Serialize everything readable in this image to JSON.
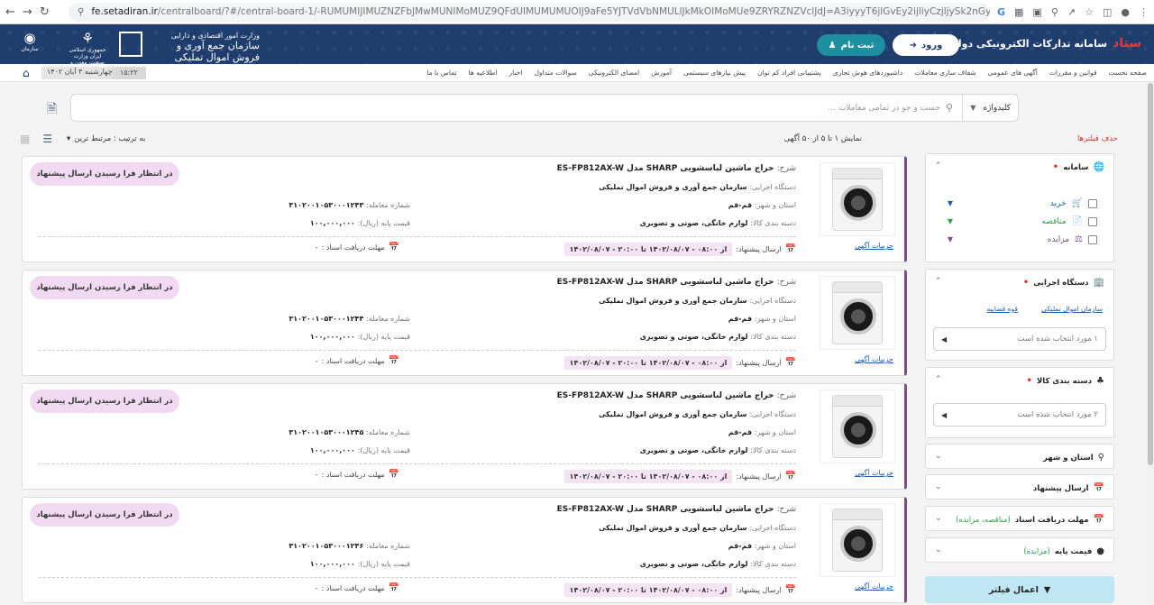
{
  "browser": {
    "host": "fe.setadiran.ir",
    "path": "/centralboard/?#/central-board-1/-RUMUMIJIMUZNZFbJMwMUNIMoMUZ9QFdUIMUMUMUOIJ9aFe5YJTVdVbNMULlJkMkOIMoMUe9ZRYRZNZVclJdJ=A3iyyyT6jlGvEy2ijliyCzjljySk2nGyTsjITzjyiyTuW0mpWn3kGjGlnyCyT0TsTxjl...",
    "g_label": "G"
  },
  "header": {
    "brand_title": "سامانه تدارکات الکترونیکی دولت",
    "brand_logo": "ستاد",
    "login_label": "ورود",
    "register_label": "ثبت نام",
    "org_sub": "وزارت امور اقتصادی و دارایی",
    "org_main": "سازمان جمع آوری و فروش اموال تملیکی",
    "ministry_label": "جمهوری اسلامی ایران وزارت صنعت، معدن و تجارت",
    "emblem3_label": "سازمان"
  },
  "menu": {
    "items": [
      "صفحه نخست",
      "قوانین و مقررات",
      "آگهی های عمومی",
      "شفاف سازی معاملات",
      "داشبوردهای هوش تجاری",
      "پشتیبانی افراد کم توان",
      "پیش نیازهای سیستمی",
      "آموزش",
      "امضای الکترونیکی",
      "سوالات متداول",
      "اخبار",
      "اطلاعیه ها",
      "تماس با ما"
    ],
    "date": "چهارشنبه ۳ آبان ۱۴۰۲",
    "time": "۱۵:۲۲"
  },
  "search": {
    "keyword_label": "کلیدواژه",
    "placeholder": "جست و جو در تمامی معاملات ..."
  },
  "toolbar": {
    "showing": "نمایش ۱ تا ۵ از ۵۰ آگهی",
    "clear_filters": "حذف فیلترها",
    "sort_label": "به ترتیب : مرتبط ترین"
  },
  "labels": {
    "title": "شرح:",
    "device": "دستگاه اجرایی:",
    "province": "استان و شهر:",
    "category": "دسته بندی کالا:",
    "deal_no": "شماره معامله:",
    "base_price": "قیمت پایه (ریال):",
    "send_offer": "ارسال پیشنهاد:",
    "from": "از",
    "to": "تا",
    "deadline": "مهلت دریافت اسناد :",
    "details": "جزییات آگهی"
  },
  "cards": [
    {
      "title": "حراج ماشین لباسشویی SHARP مدل ES-FP812AX-W",
      "device": "سازمان جمع آوری و فروش اموال تملیکی",
      "province": "قم-قم",
      "category": "لوازم خانگی، صوتی و تصویری",
      "deal_no": "۳۱۰۲۰۰۱۰۵۳۰۰۰۱۲۴۳",
      "base_price": "۱۰۰,۰۰۰,۰۰۰",
      "send_from": "۰۸:۰۰ - ۱۴۰۲/۰۸/۰۷",
      "send_to": "۲۰:۰۰ - ۱۴۰۲/۰۸/۰۷",
      "deadline_value": "-",
      "status": "در انتظار فرا رسیدن ارسال پیشنهاد"
    },
    {
      "title": "حراج ماشین لباسشویی SHARP مدل ES-FP812AX-W",
      "device": "سازمان جمع آوری و فروش اموال تملیکی",
      "province": "قم-قم",
      "category": "لوازم خانگی، صوتی و تصویری",
      "deal_no": "۳۱۰۲۰۰۱۰۵۳۰۰۰۱۲۴۴",
      "base_price": "۱۰۰,۰۰۰,۰۰۰",
      "send_from": "۰۸:۰۰ - ۱۴۰۲/۰۸/۰۷",
      "send_to": "۲۰:۰۰ - ۱۴۰۲/۰۸/۰۷",
      "deadline_value": "-",
      "status": "در انتظار فرا رسیدن ارسال پیشنهاد"
    },
    {
      "title": "حراج ماشین لباسشویی SHARP مدل ES-FP812AX-W",
      "device": "سازمان جمع آوری و فروش اموال تملیکی",
      "province": "قم-قم",
      "category": "لوازم خانگی، صوتی و تصویری",
      "deal_no": "۳۱۰۲۰۰۱۰۵۳۰۰۰۱۲۴۵",
      "base_price": "۱۰۰,۰۰۰,۰۰۰",
      "send_from": "۰۸:۰۰ - ۱۴۰۲/۰۸/۰۷",
      "send_to": "۲۰:۰۰ - ۱۴۰۲/۰۸/۰۷",
      "deadline_value": "-",
      "status": "در انتظار فرا رسیدن ارسال پیشنهاد"
    },
    {
      "title": "حراج ماشین لباسشویی SHARP مدل ES-FP812AX-W",
      "device": "سازمان جمع آوری و فروش اموال تملیکی",
      "province": "قم-قم",
      "category": "لوازم خانگی، صوتی و تصویری",
      "deal_no": "۳۱۰۲۰۰۱۰۵۳۰۰۰۱۲۴۶",
      "base_price": "۱۰۰,۰۰۰,۰۰۰",
      "send_from": "۰۸:۰۰ - ۱۴۰۲/۰۸/۰۷",
      "send_to": "۲۰:۰۰ - ۱۴۰۲/۰۸/۰۷",
      "deadline_value": "-",
      "status": "در انتظار فرا رسیدن ارسال پیشنهاد"
    }
  ],
  "sidebar": {
    "system": {
      "title": "سامانه",
      "options": [
        {
          "label": "خرید",
          "color": "#1f5ea8"
        },
        {
          "label": "مناقصه",
          "color": "#2e9d4a"
        },
        {
          "label": "مزایده",
          "color": "#7a4b8d"
        }
      ]
    },
    "device": {
      "title": "دستگاه اجرایی",
      "tags": [
        "سازمان اموال تملیکی",
        "قوه قضاییه"
      ],
      "select": "۱ مورد انتخاب شده است"
    },
    "category": {
      "title": "دسته بندی کالا",
      "select": "۲ مورد انتخاب شده است"
    },
    "collapsed": [
      {
        "title": "استان و شهر",
        "note": ""
      },
      {
        "title": "ارسال پیشنهاد",
        "note": ""
      },
      {
        "title": "مهلت دریافت اسناد",
        "note": "(مناقصه، مزایده)"
      },
      {
        "title": "قیمت پایه",
        "note": "(مزایده)"
      }
    ],
    "apply_label": "اعمال فیلتر"
  },
  "colors": {
    "header_bg": "#1f3e6e",
    "accent_purple": "#7a4b8d",
    "status_bg": "#f1d9f1",
    "apply_bg": "#bfe6f3",
    "register_bg": "#1d8fa0"
  }
}
